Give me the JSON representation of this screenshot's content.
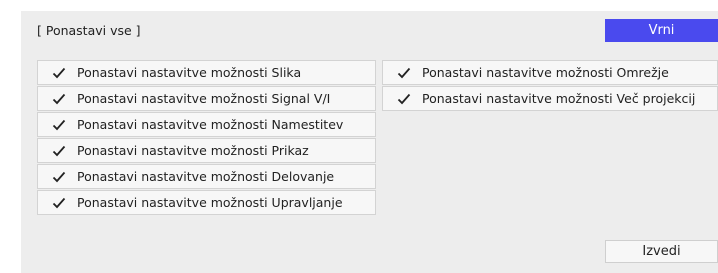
{
  "dialog": {
    "title": "[ Ponastavi vse ]",
    "back_button": "Vrni",
    "execute_button": "Izvedi"
  },
  "colors": {
    "panel_background": "#ededed",
    "accent_button": "#4a4aee",
    "item_background": "#f7f7f7",
    "item_border": "#d3d3d3"
  },
  "items_left": [
    {
      "label": "Ponastavi nastavitve možnosti Slika",
      "checked": true
    },
    {
      "label": "Ponastavi nastavitve možnosti Signal V/I",
      "checked": true
    },
    {
      "label": "Ponastavi nastavitve možnosti Namestitev",
      "checked": true
    },
    {
      "label": "Ponastavi nastavitve možnosti Prikaz",
      "checked": true
    },
    {
      "label": "Ponastavi nastavitve možnosti Delovanje",
      "checked": true
    },
    {
      "label": "Ponastavi nastavitve možnosti Upravljanje",
      "checked": true
    }
  ],
  "items_right": [
    {
      "label": "Ponastavi nastavitve možnosti Omrežje",
      "checked": true
    },
    {
      "label": "Ponastavi nastavitve možnosti Več projekcij",
      "checked": true
    }
  ],
  "icons": {
    "item_check": "checkmark-icon"
  }
}
